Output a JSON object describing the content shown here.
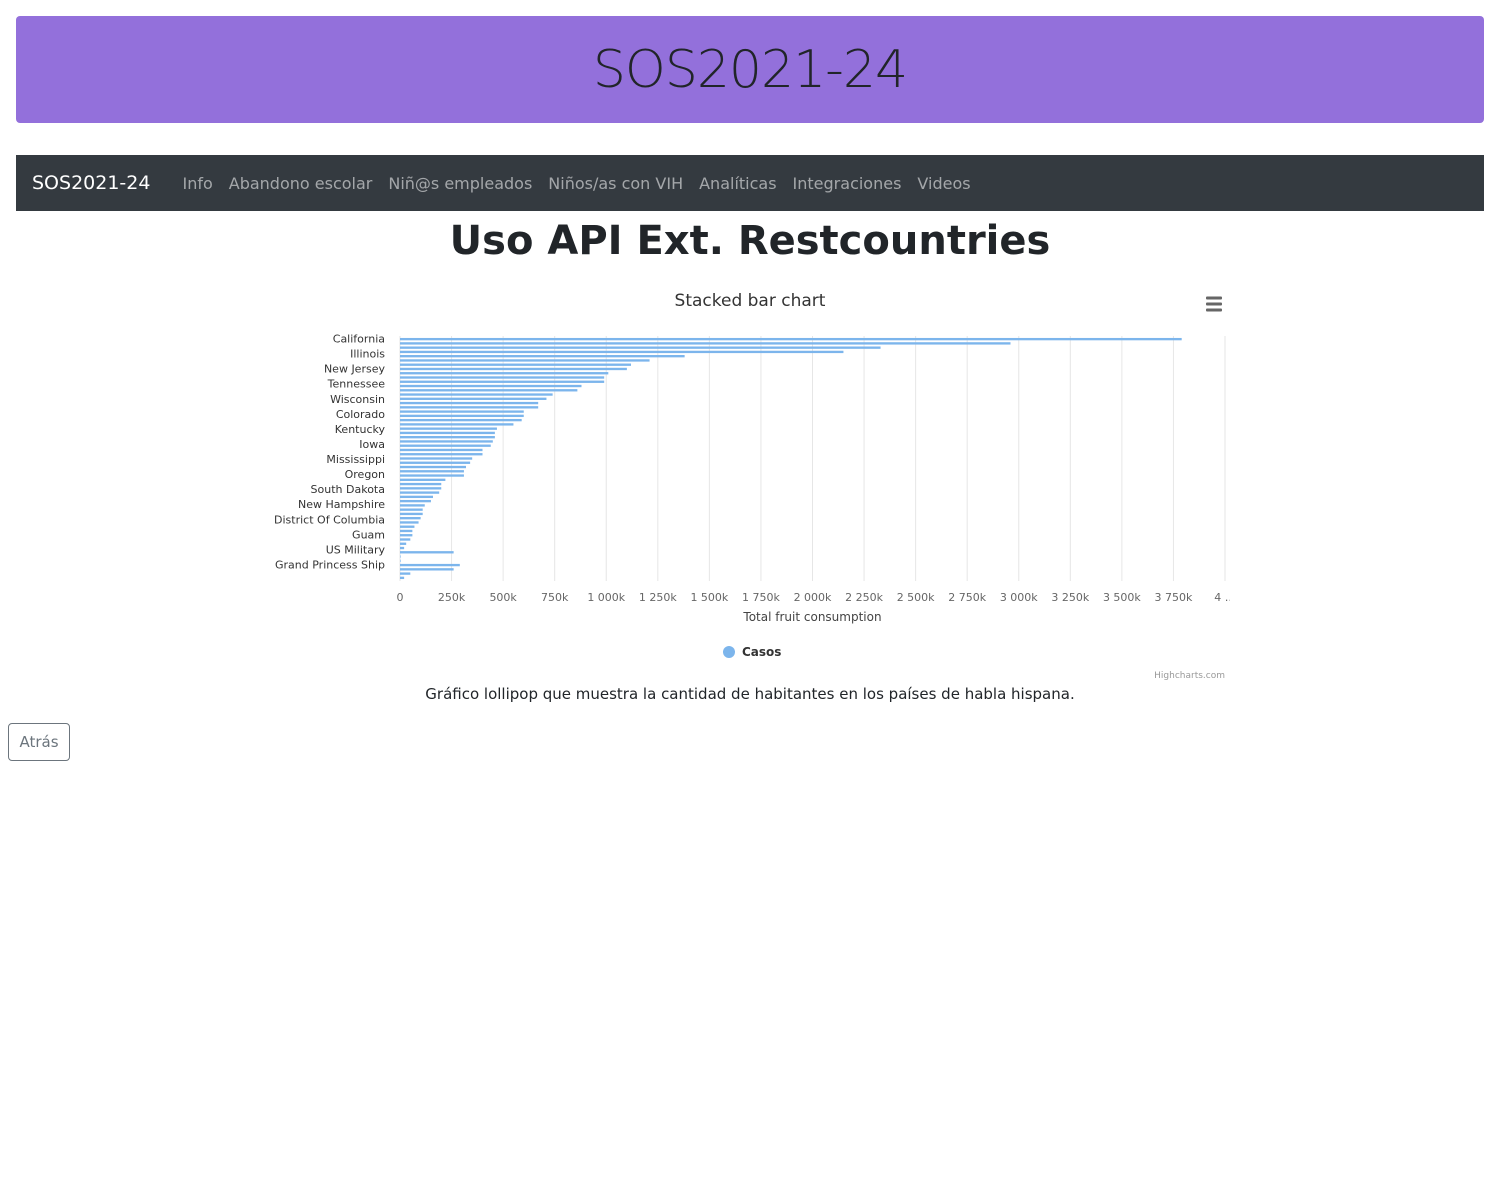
{
  "header": {
    "title": "SOS2021-24"
  },
  "navbar": {
    "brand": "SOS2021-24",
    "items": [
      {
        "label": "Info"
      },
      {
        "label": "Abandono escolar"
      },
      {
        "label": "Niñ@s empleados"
      },
      {
        "label": "Niños/as con VIH"
      },
      {
        "label": "Analíticas"
      },
      {
        "label": "Integraciones"
      },
      {
        "label": "Videos"
      }
    ]
  },
  "page": {
    "heading": "Uso API Ext. Restcountries",
    "caption": "Gráfico lollipop que muestra la cantidad de habitantes en los países de habla hispana.",
    "back_label": "Atrás"
  },
  "chart_menu_icon": "hamburger-menu-icon",
  "chart_data": {
    "type": "bar",
    "title": "Stacked bar chart",
    "xlabel": "Total fruit consumption",
    "ylabel": "",
    "credits": "Highcharts.com",
    "series_color": "#7cb5ec",
    "grid": true,
    "legend_position": "bottom-center",
    "xlim": [
      0,
      4000000
    ],
    "ticks": [
      "0",
      "250k",
      "500k",
      "750k",
      "1 000k",
      "1 250k",
      "1 500k",
      "1 750k",
      "2 000k",
      "2 250k",
      "2 500k",
      "2 750k",
      "3 000k",
      "3 250k",
      "3 500k",
      "3 750k",
      "4 …"
    ],
    "categories": [
      "California",
      "Illinois",
      "New Jersey",
      "Tennessee",
      "Wisconsin",
      "Colorado",
      "Kentucky",
      "Iowa",
      "Mississippi",
      "Oregon",
      "South Dakota",
      "New Hampshire",
      "District Of Columbia",
      "Guam",
      "US Military",
      "Grand Princess Ship"
    ],
    "series": [
      {
        "name": "Casos",
        "values": [
          3790000,
          2960000,
          2330000,
          2150000,
          1380000,
          1210000,
          1120000,
          1100000,
          1010000,
          990000,
          990000,
          880000,
          860000,
          740000,
          710000,
          670000,
          670000,
          600000,
          600000,
          590000,
          550000,
          470000,
          460000,
          460000,
          450000,
          440000,
          400000,
          400000,
          350000,
          340000,
          320000,
          310000,
          310000,
          220000,
          200000,
          200000,
          190000,
          160000,
          150000,
          120000,
          110000,
          110000,
          100000,
          90000,
          70000,
          60000,
          60000,
          50000,
          30000,
          20000,
          260000,
          3000,
          3000,
          290000,
          260000,
          50000,
          20000
        ]
      }
    ]
  }
}
